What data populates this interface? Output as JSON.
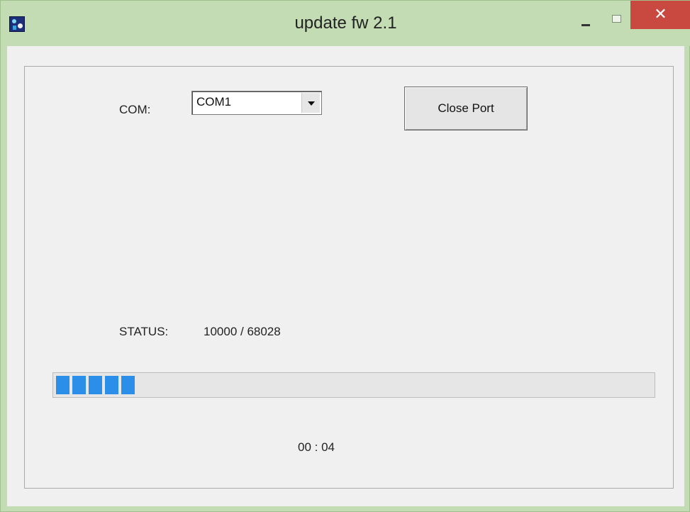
{
  "window": {
    "title": "update fw 2.1",
    "close_glyph": "✕"
  },
  "form": {
    "com_label": "COM:",
    "com_selected": "COM1",
    "close_port_label": "Close Port",
    "status_label": "STATUS:",
    "status_value": "10000 / 68028",
    "progress_fraction": 0.147,
    "timer": "00 : 04"
  },
  "colors": {
    "titlebar": "#c4dcb4",
    "close_button": "#c9483f",
    "progress_fill": "#2b8fe9"
  },
  "icons": {
    "app": "app-icon",
    "minimize": "minimize-icon",
    "maximize": "maximize-icon",
    "close": "close-icon",
    "dropdown": "chevron-down-icon"
  }
}
